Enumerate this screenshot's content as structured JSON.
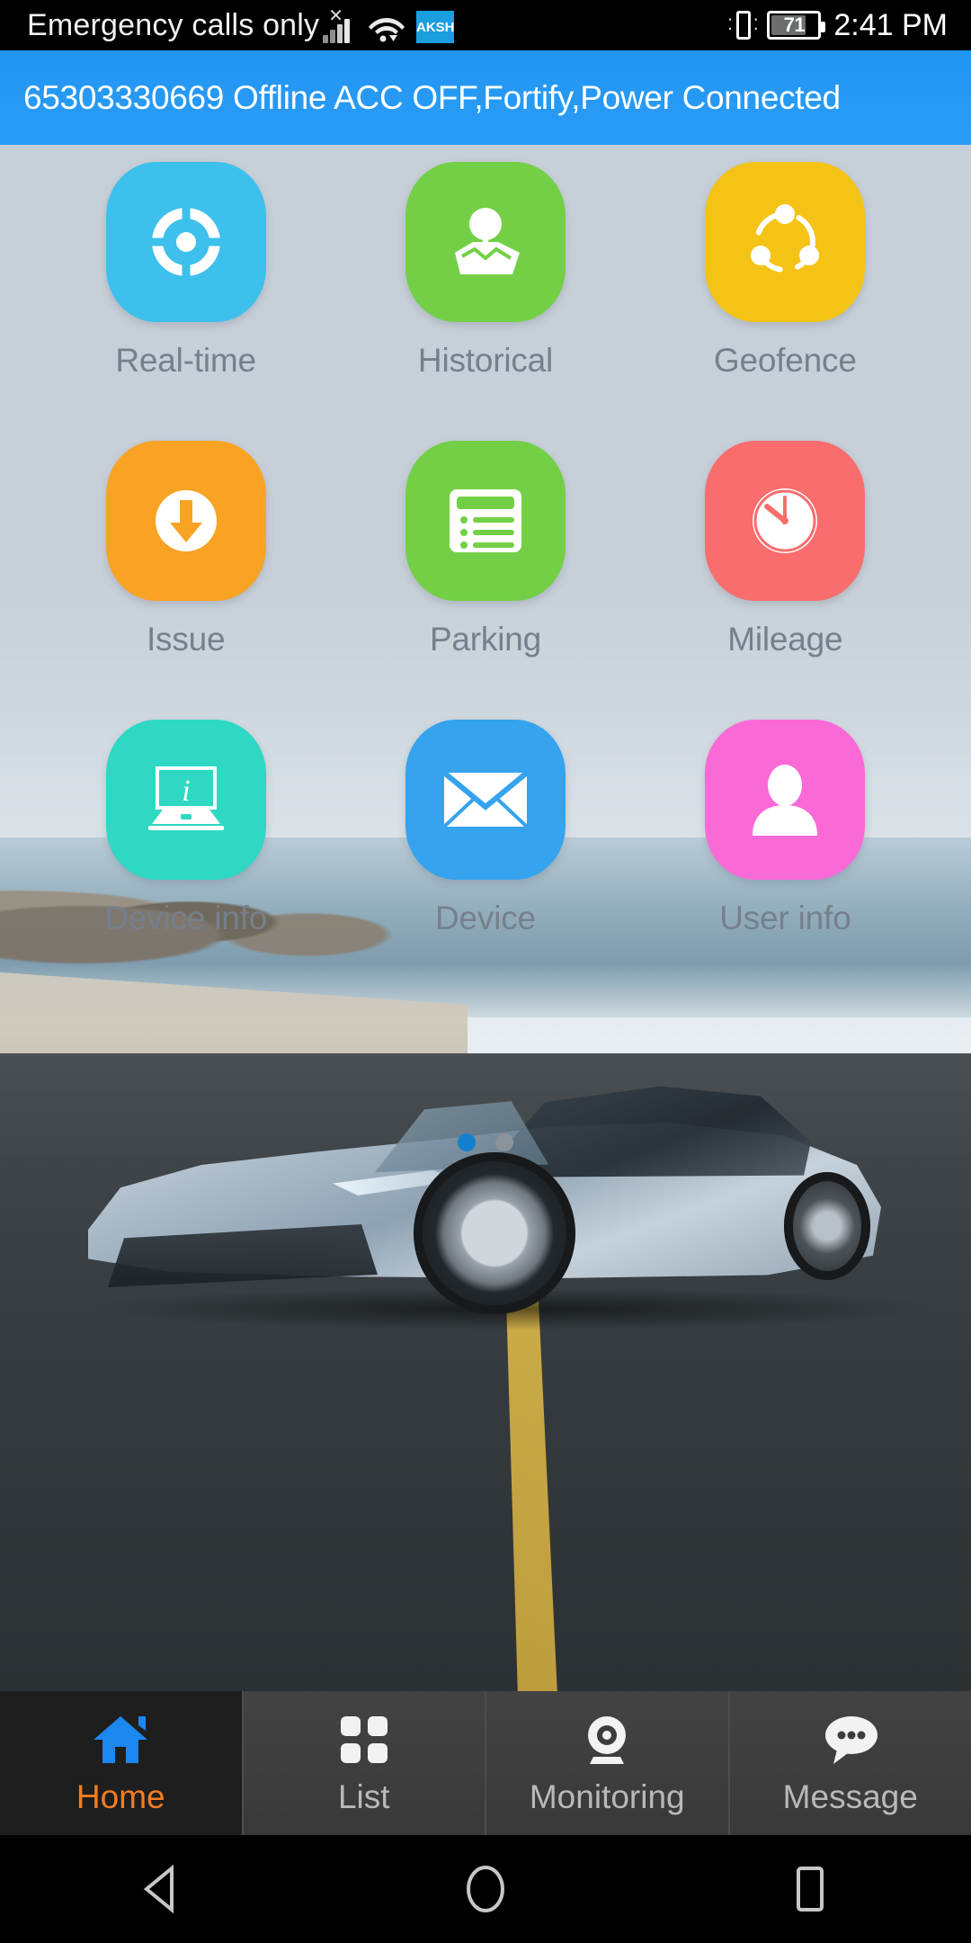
{
  "status_bar": {
    "carrier_text": "Emergency calls only",
    "signal_icon": "signal-bars-icon",
    "no_sim_icon": "no-sim-x-icon",
    "wifi_icon": "wifi-icon",
    "carrier_badge": "AKSH",
    "vibrate_icon": "vibrate-icon",
    "battery_level": "71",
    "battery_icon": "battery-icon",
    "time": "2:41 PM"
  },
  "banner": {
    "text": "65303330669 Offline ACC OFF,Fortify,Power Connected",
    "background_color": "#2196f3",
    "text_color": "#ffffff"
  },
  "grid": {
    "items": [
      {
        "label": "Real-time",
        "icon": "crosshair-target-icon",
        "color": "#3dc0ec"
      },
      {
        "label": "Historical",
        "icon": "map-pin-icon",
        "color": "#73d046"
      },
      {
        "label": "Geofence",
        "icon": "share-nodes-icon",
        "color": "#f4c316"
      },
      {
        "label": "Issue",
        "icon": "download-arrow-icon",
        "color": "#f8a324"
      },
      {
        "label": "Parking",
        "icon": "list-receipt-icon",
        "color": "#73d046"
      },
      {
        "label": "Mileage",
        "icon": "stopwatch-gauge-icon",
        "color": "#f96d6d"
      },
      {
        "label": "Device info",
        "icon": "laptop-info-icon",
        "color": "#2ed8c3"
      },
      {
        "label": "Device",
        "icon": "envelope-icon",
        "color": "#35a3ee"
      },
      {
        "label": "User info",
        "icon": "person-icon",
        "color": "#fa6ad7"
      }
    ]
  },
  "pager": {
    "pages": 2,
    "active_index": 0,
    "active_color": "#1380cf",
    "inactive_color": "#8b949b"
  },
  "tab_bar": {
    "active_index": 0,
    "active_color": "#f57c20",
    "inactive_color": "#b9b9b9",
    "tabs": [
      {
        "label": "Home",
        "icon": "home-icon"
      },
      {
        "label": "List",
        "icon": "grid-squares-icon"
      },
      {
        "label": "Monitoring",
        "icon": "webcam-icon"
      },
      {
        "label": "Message",
        "icon": "chat-bubble-icon"
      }
    ]
  },
  "nav_bar": {
    "buttons": [
      {
        "icon": "back-triangle-icon"
      },
      {
        "icon": "home-circle-icon"
      },
      {
        "icon": "recents-square-icon"
      }
    ]
  },
  "wallpaper": {
    "description": "silver sports car on coastal road"
  }
}
